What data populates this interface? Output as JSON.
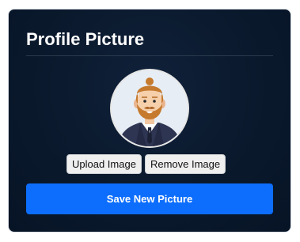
{
  "card": {
    "title": "Profile Picture"
  },
  "avatar": {
    "icon": "bearded-man-avatar-icon"
  },
  "actions": {
    "upload_label": "Upload Image",
    "remove_label": "Remove Image",
    "save_label": "Save New Picture"
  },
  "colors": {
    "card_background": "#0b1a2e",
    "accent": "#0d6efd",
    "secondary_button": "#efefef"
  }
}
